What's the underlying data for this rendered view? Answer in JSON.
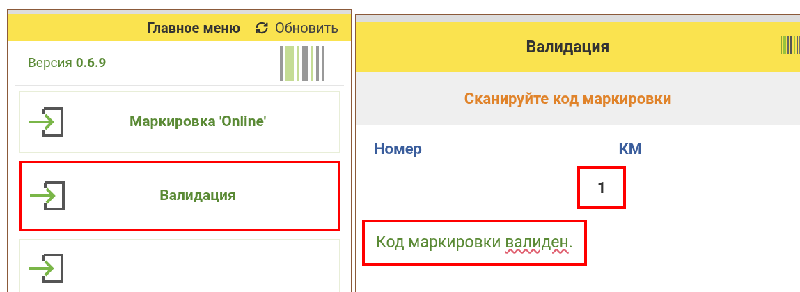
{
  "main_menu": {
    "title": "Главное меню",
    "refresh_button": "Обновить",
    "version_label": "Версия",
    "version": "0.6.9",
    "items": [
      {
        "kind": "entry",
        "label": "Маркировка 'Online'",
        "highlighted": false
      },
      {
        "kind": "entry",
        "label": "Валидация",
        "highlighted": true
      },
      {
        "kind": "cut_off",
        "highlighted": false
      }
    ]
  },
  "validation_screen": {
    "title": "Валидация",
    "prompt": "Сканируйте код маркировки",
    "columns": [
      "Номер",
      "КМ"
    ],
    "rows": [
      {
        "number_cell": "",
        "km": "1",
        "highlighted": true
      }
    ],
    "message": {
      "before": "Код маркировки ",
      "flagged_word": "валиден",
      "after": ".",
      "highlighted": true
    }
  }
}
